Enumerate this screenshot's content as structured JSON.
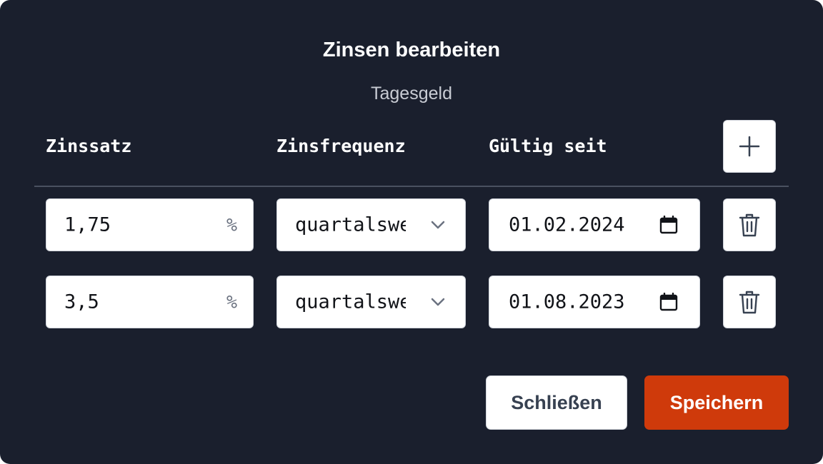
{
  "dialog": {
    "title": "Zinsen bearbeiten",
    "subtitle": "Tagesgeld"
  },
  "columns": {
    "rate": "Zinssatz",
    "frequency": "Zinsfrequenz",
    "valid_since": "Gültig seit"
  },
  "add_button_icon": "plus-icon",
  "rows": [
    {
      "rate": "1,75",
      "unit": "%",
      "frequency": "quartalsweise",
      "valid_since": "01.02.2024"
    },
    {
      "rate": "3,5",
      "unit": "%",
      "frequency": "quartalsweise",
      "valid_since": "01.08.2023"
    }
  ],
  "delete_button_icon": "trash-icon",
  "buttons": {
    "close": "Schließen",
    "save": "Speichern"
  },
  "colors": {
    "background": "#1a1f2d",
    "primary": "#cf3a0b"
  }
}
